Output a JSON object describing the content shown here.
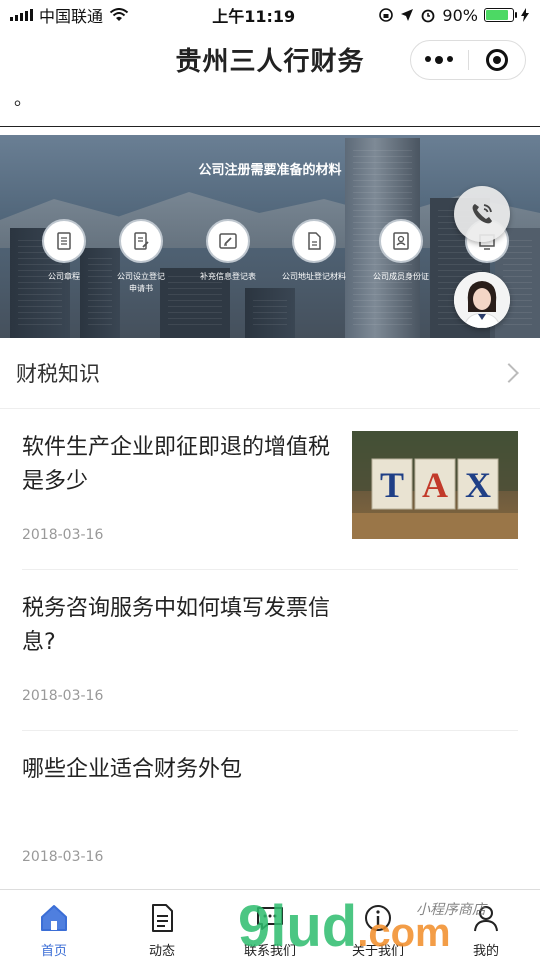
{
  "status": {
    "carrier": "中国联通",
    "time": "上午11:19",
    "battery": "90%",
    "battery_level": 0.9
  },
  "navbar": {
    "title": "贵州三人行财务",
    "more_icon": "more-dots-icon",
    "close_icon": "target-close-icon"
  },
  "top_text": "。",
  "banner": {
    "title": "公司注册需要准备的材料",
    "items": [
      {
        "label": "公司章程",
        "icon": "document-icon"
      },
      {
        "label": "公司设立登记申请书",
        "icon": "edit-document-icon"
      },
      {
        "label": "补充信息登记表",
        "icon": "form-edit-icon"
      },
      {
        "label": "公司地址登记材料",
        "icon": "file-icon"
      },
      {
        "label": "公司成员身份证",
        "icon": "id-card-icon"
      },
      {
        "label": "",
        "icon": "certificate-icon"
      }
    ]
  },
  "section": {
    "title": "财税知识"
  },
  "articles": [
    {
      "title": "软件生产企业即征即退的增值税是多少",
      "date": "2018-03-16",
      "image_text": "TAX"
    },
    {
      "title": "税务咨询服务中如何填写发票信息?",
      "date": "2018-03-16"
    },
    {
      "title": "哪些企业适合财务外包",
      "date": "2018-03-16"
    }
  ],
  "tabbar": [
    {
      "label": "首页",
      "icon": "home-icon",
      "active": true
    },
    {
      "label": "动态",
      "icon": "news-icon",
      "active": false
    },
    {
      "label": "联系我们",
      "icon": "chat-icon",
      "active": false
    },
    {
      "label": "关于我们",
      "icon": "info-icon",
      "active": false
    },
    {
      "label": "我的",
      "icon": "user-icon",
      "active": false
    }
  ],
  "watermark": {
    "text": "9lud.com",
    "sub": "小程序商店"
  },
  "colors": {
    "accent": "#3b6ed6",
    "watermark_green": "#2dbd6e",
    "watermark_orange": "#f28c28"
  }
}
